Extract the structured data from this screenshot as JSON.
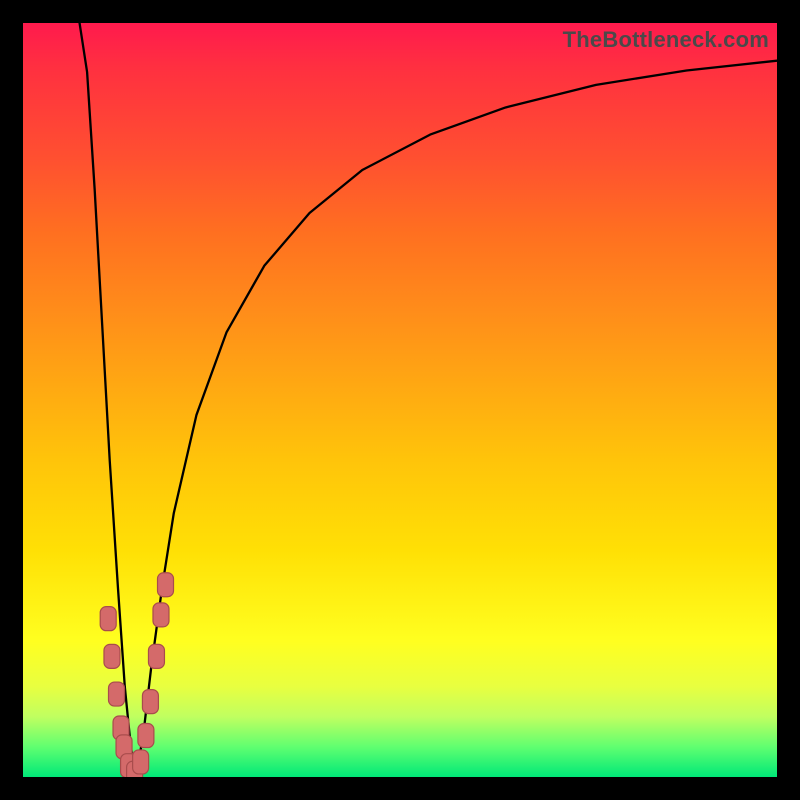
{
  "watermark_text": "TheBottleneck.com",
  "colors": {
    "frame_bg": "#000000",
    "curve": "#000000",
    "marker_fill": "#d46a6a",
    "marker_stroke": "#a84c4c"
  },
  "chart_data": {
    "type": "line",
    "title": "",
    "xlabel": "",
    "ylabel": "",
    "xlim": [
      0,
      1
    ],
    "ylim": [
      0,
      1
    ],
    "x_minimum": 0.15,
    "series": [
      {
        "name": "bottleneck-curve",
        "x": [
          0.075,
          0.085,
          0.095,
          0.105,
          0.115,
          0.126,
          0.135,
          0.143,
          0.15,
          0.16,
          0.17,
          0.185,
          0.2,
          0.23,
          0.27,
          0.32,
          0.38,
          0.45,
          0.54,
          0.64,
          0.76,
          0.88,
          1.0
        ],
        "values": [
          1.0,
          0.935,
          0.78,
          0.6,
          0.42,
          0.25,
          0.12,
          0.04,
          0.0,
          0.06,
          0.145,
          0.255,
          0.35,
          0.48,
          0.59,
          0.678,
          0.748,
          0.805,
          0.852,
          0.888,
          0.918,
          0.937,
          0.95
        ]
      }
    ],
    "markers": {
      "name": "highlighted-range",
      "x": [
        0.113,
        0.118,
        0.124,
        0.13,
        0.134,
        0.14,
        0.148,
        0.156,
        0.163,
        0.169,
        0.177,
        0.183,
        0.189
      ],
      "values": [
        0.21,
        0.16,
        0.11,
        0.065,
        0.04,
        0.015,
        0.005,
        0.02,
        0.055,
        0.1,
        0.16,
        0.215,
        0.255
      ]
    },
    "gradient_stops": [
      {
        "pos": 0.0,
        "color": "#ff1a4d"
      },
      {
        "pos": 0.06,
        "color": "#ff3040"
      },
      {
        "pos": 0.18,
        "color": "#ff5030"
      },
      {
        "pos": 0.28,
        "color": "#ff7020"
      },
      {
        "pos": 0.38,
        "color": "#ff8c1a"
      },
      {
        "pos": 0.48,
        "color": "#ffa812"
      },
      {
        "pos": 0.58,
        "color": "#ffc40a"
      },
      {
        "pos": 0.7,
        "color": "#ffe005"
      },
      {
        "pos": 0.82,
        "color": "#ffff20"
      },
      {
        "pos": 0.88,
        "color": "#e8ff40"
      },
      {
        "pos": 0.92,
        "color": "#c0ff60"
      },
      {
        "pos": 0.96,
        "color": "#60ff70"
      },
      {
        "pos": 1.0,
        "color": "#00e878"
      }
    ]
  }
}
